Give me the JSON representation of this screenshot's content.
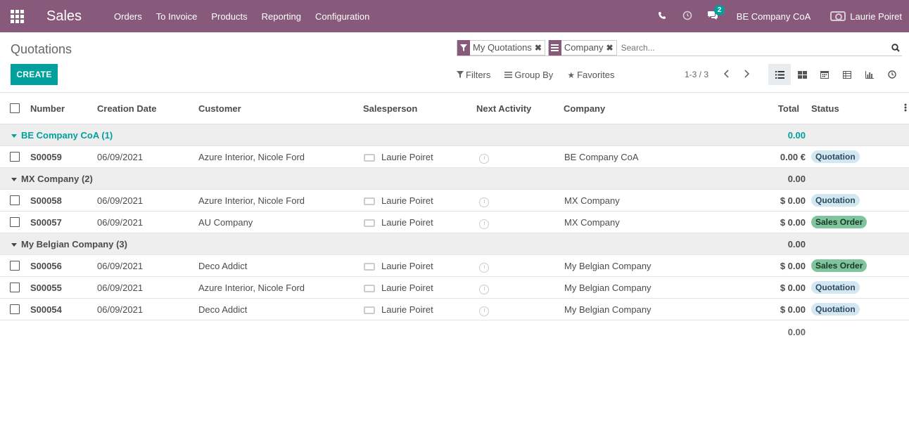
{
  "navbar": {
    "app_name": "Sales",
    "menu": [
      "Orders",
      "To Invoice",
      "Products",
      "Reporting",
      "Configuration"
    ],
    "chat_count": "2",
    "company": "BE Company CoA",
    "user": "Laurie Poiret",
    "accent_color": "#875a7b"
  },
  "control": {
    "breadcrumb": "Quotations",
    "create_label": "CREATE",
    "facets": [
      {
        "icon": "filter-icon",
        "label": "My Quotations"
      },
      {
        "icon": "group-by-icon",
        "label": "Company"
      }
    ],
    "search_placeholder": "Search...",
    "filters_label": "Filters",
    "groupby_label": "Group By",
    "favorites_label": "Favorites",
    "pager": "1-3 / 3",
    "primary_color": "#00a09d"
  },
  "table": {
    "columns": [
      "Number",
      "Creation Date",
      "Customer",
      "Salesperson",
      "Next Activity",
      "Company",
      "Total",
      "Status"
    ],
    "rows": [
      {
        "kind": "group",
        "name": "BE Company CoA (1)",
        "total": "0.00"
      },
      {
        "kind": "record",
        "number": "S00059",
        "date": "06/09/2021",
        "customer": "Azure Interior, Nicole Ford",
        "salesperson": "Laurie Poiret",
        "company": "BE Company CoA",
        "total": "0.00 €",
        "status": "Quotation"
      },
      {
        "kind": "group",
        "name": "MX Company (2)",
        "total": "0.00"
      },
      {
        "kind": "record",
        "number": "S00058",
        "date": "06/09/2021",
        "customer": "Azure Interior, Nicole Ford",
        "salesperson": "Laurie Poiret",
        "company": "MX Company",
        "total": "$ 0.00",
        "status": "Quotation"
      },
      {
        "kind": "record",
        "number": "S00057",
        "date": "06/09/2021",
        "customer": "AU Company",
        "salesperson": "Laurie Poiret",
        "company": "MX Company",
        "total": "$ 0.00",
        "status": "Sales Order"
      },
      {
        "kind": "group",
        "name": "My Belgian Company (3)",
        "total": "0.00"
      },
      {
        "kind": "record",
        "number": "S00056",
        "date": "06/09/2021",
        "customer": "Deco Addict",
        "salesperson": "Laurie Poiret",
        "company": "My Belgian Company",
        "total": "$ 0.00",
        "status": "Sales Order"
      },
      {
        "kind": "record",
        "number": "S00055",
        "date": "06/09/2021",
        "customer": "Azure Interior, Nicole Ford",
        "salesperson": "Laurie Poiret",
        "company": "My Belgian Company",
        "total": "$ 0.00",
        "status": "Quotation"
      },
      {
        "kind": "record",
        "number": "S00054",
        "date": "06/09/2021",
        "customer": "Deco Addict",
        "salesperson": "Laurie Poiret",
        "company": "My Belgian Company",
        "total": "$ 0.00",
        "status": "Quotation"
      }
    ],
    "grand_total": "0.00"
  }
}
